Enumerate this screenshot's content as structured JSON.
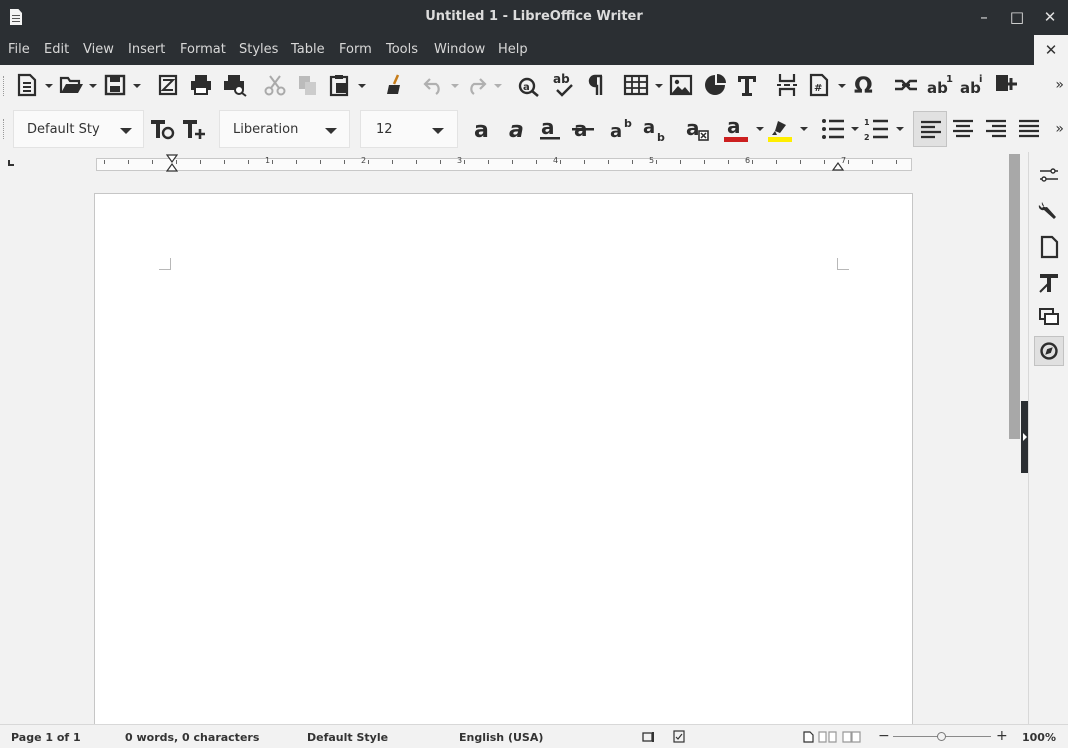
{
  "window": {
    "title": "Untitled 1 - LibreOffice Writer",
    "minimize": "–",
    "maximize": "□",
    "close": "✕"
  },
  "menu": {
    "items": [
      "File",
      "Edit",
      "View",
      "Insert",
      "Format",
      "Styles",
      "Table",
      "Form",
      "Tools",
      "Window",
      "Help"
    ],
    "close_doc": "✕"
  },
  "standard_toolbar": {
    "icons": [
      "new-document",
      "open",
      "save",
      "export-pdf",
      "print",
      "print-preview",
      "cut",
      "copy",
      "paste",
      "clone-formatting",
      "undo",
      "redo",
      "find-replace",
      "spelling",
      "formatting-marks",
      "insert-table",
      "insert-image",
      "insert-chart",
      "insert-text-box",
      "page-break",
      "insert-field",
      "special-character",
      "hyperlink",
      "footnote",
      "endnote",
      "comment"
    ],
    "overflow": "»"
  },
  "formatting_toolbar": {
    "paragraph_style": "Default Sty",
    "font_name": "Liberation",
    "font_size": "12",
    "font_color": "#cc1f1f",
    "highlight_color": "#ffee00",
    "overflow": "»"
  },
  "ruler": {
    "marks": [
      "1",
      "2",
      "3",
      "4",
      "5",
      "6",
      "7"
    ]
  },
  "statusbar": {
    "page": "Page 1 of 1",
    "words": "0 words, 0 characters",
    "style": "Default Style",
    "language": "English (USA)",
    "zoom": "100%",
    "zoom_fraction": 0.5
  }
}
